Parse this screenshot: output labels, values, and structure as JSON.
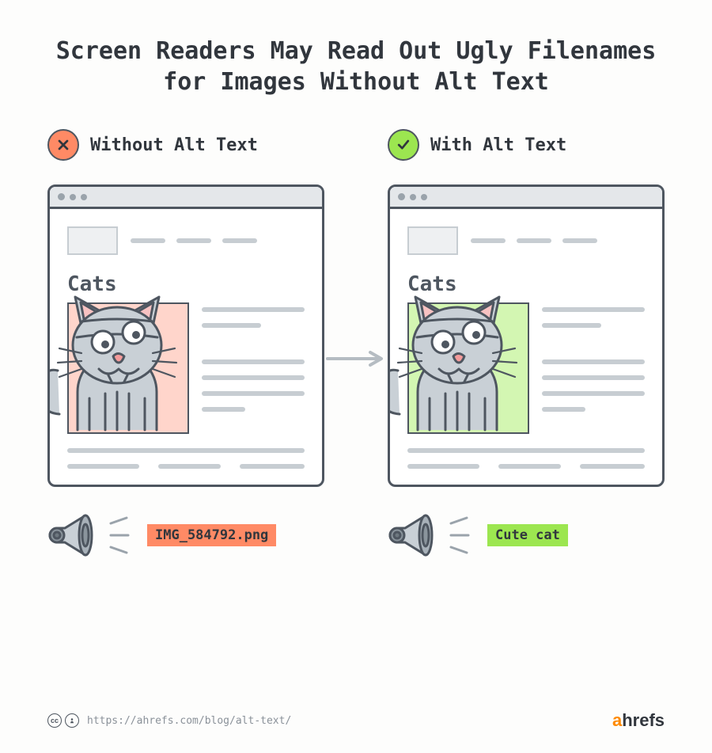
{
  "title": "Screen Readers May Read Out Ugly Filenames for Images Without Alt Text",
  "left": {
    "badge_label": "Without Alt Text",
    "page_title": "Cats",
    "utterance": "IMG_584792.png"
  },
  "right": {
    "badge_label": "With Alt Text",
    "page_title": "Cats",
    "utterance": "Cute cat"
  },
  "footer": {
    "url": "https://ahrefs.com/blog/alt-text/",
    "brand": "ahrefs"
  }
}
